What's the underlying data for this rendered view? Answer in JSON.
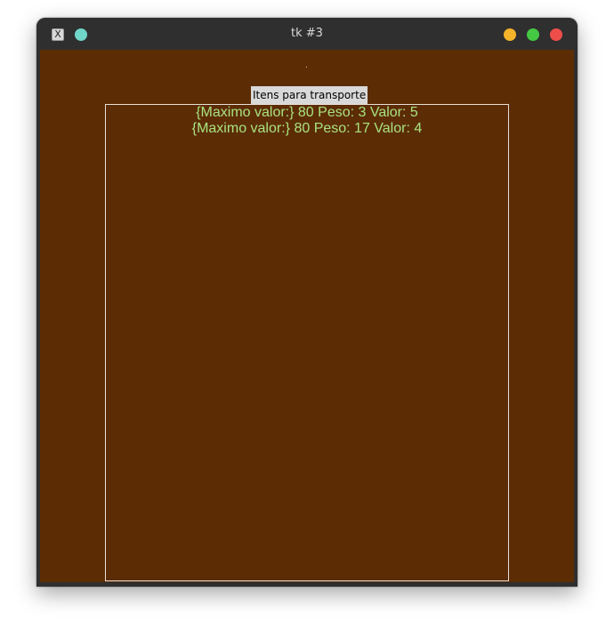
{
  "window": {
    "title": "tk #3",
    "app_icon_glyph": "X"
  },
  "main": {
    "list_label": "Itens para transporte",
    "items": [
      "{Maximo valor:} 80 Peso: 3 Valor: 5",
      "{Maximo valor:} 80 Peso: 17 Valor: 4"
    ]
  },
  "colors": {
    "background": "#5c2c05",
    "list_text": "#a8e37e",
    "titlebar": "#2f2f2f",
    "pin": "#6fd6c8",
    "minimize": "#f5b42a",
    "maximize": "#45c843",
    "close": "#ee4e4a"
  }
}
